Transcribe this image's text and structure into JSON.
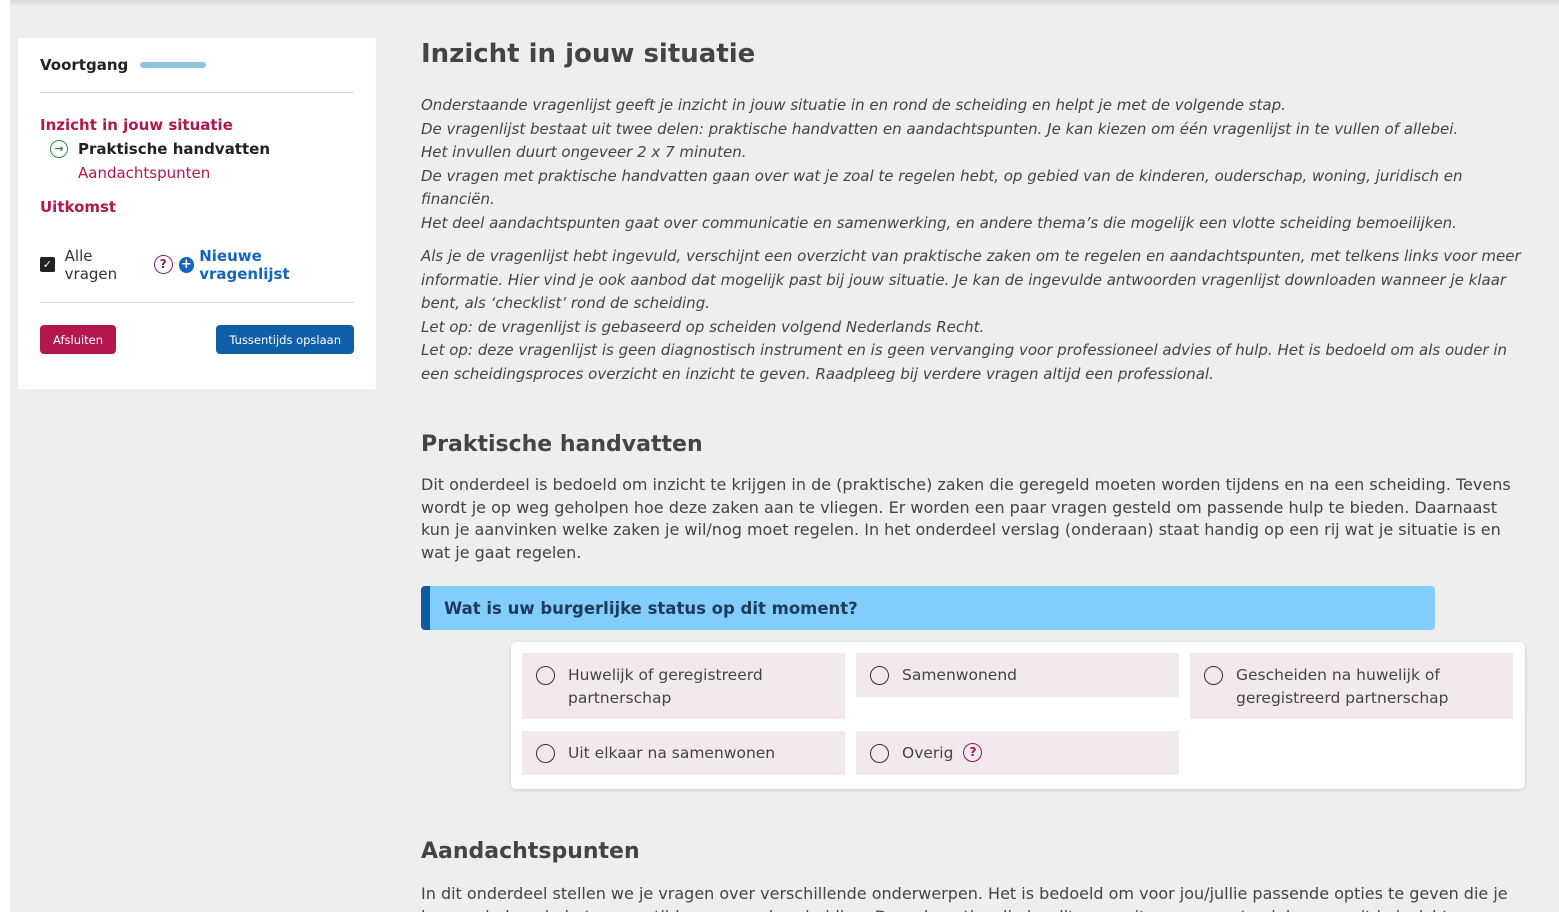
{
  "sidebar": {
    "progress_label": "Voortgang",
    "nav": {
      "section1": "Inzicht in jouw situatie",
      "sub_active": "Praktische handvatten",
      "sub_other": "Aandachtspunten",
      "section2": "Uitkomst"
    },
    "all_questions_label": "Alle vragen",
    "new_questionnaire_label": "Nieuwe vragenlijst",
    "close_button": "Afsluiten",
    "save_button": "Tussentijds opslaan"
  },
  "main": {
    "title": "Inzicht in jouw situatie",
    "intro_block1": [
      "Onderstaande vragenlijst geeft je inzicht in jouw situatie in en rond de scheiding en helpt je met de volgende stap.",
      "De vragenlijst bestaat uit twee delen: praktische handvatten en aandachtspunten. Je kan kiezen om één vragenlijst in te vullen of allebei.",
      "Het invullen duurt ongeveer 2 x 7 minuten.",
      "De vragen met praktische handvatten gaan over wat je zoal te regelen hebt, op gebied van de kinderen, ouderschap, woning, juridisch en financiën.",
      "Het deel aandachtspunten gaat over communicatie en samenwerking, en andere thema’s die mogelijk een vlotte scheiding bemoeilijken."
    ],
    "intro_block2": [
      "Als je de vragenlijst hebt ingevuld, verschijnt een overzicht van praktische zaken om te regelen en aandachtspunten, met telkens links voor meer informatie. Hier vind je ook aanbod dat mogelijk past bij jouw situatie. Je kan de ingevulde antwoorden vragenlijst downloaden wanneer je klaar bent, als ‘checklist’ rond de scheiding.",
      "Let op: de vragenlijst is gebaseerd op scheiden volgend Nederlands Recht.",
      "Let op: deze vragenlijst is geen diagnostisch instrument en is geen vervanging voor professioneel advies of hulp. Het is bedoeld om als ouder in een scheidingsproces overzicht en inzicht te geven. Raadpleeg bij verdere vragen altijd een professional."
    ],
    "section_practical": {
      "title": "Praktische handvatten",
      "text": "Dit onderdeel is bedoeld om inzicht te krijgen in de (praktische) zaken die geregeld moeten worden tijdens en na een scheiding. Tevens wordt je op weg geholpen hoe deze zaken aan te vliegen.  Er worden een paar vragen gesteld om passende hulp te bieden. Daarnaast kun je aanvinken welke zaken je wil/nog moet regelen. In het onderdeel verslag (onderaan) staat handig op een rij wat je situatie is en wat je gaat regelen."
    },
    "question": {
      "text": "Wat is uw burgerlijke status op dit moment?",
      "options": [
        "Huwelijk of geregistreerd partnerschap",
        "Samenwonend",
        "Gescheiden na huwelijk of geregistreerd partnerschap",
        "Uit elkaar na samenwonen",
        "Overig"
      ]
    },
    "section_attention": {
      "title": "Aandachtspunten",
      "text": "In dit onderdeel stellen we je vragen over verschillende onderwerpen. Het is bedoeld om voor jou/jullie passende opties te geven die je kunnen helpen in het proces tijdens en na de scheiding. Door de opties die je wilt gaan uitvoeren aan te vinken, groeit je inzicht."
    }
  },
  "colors": {
    "accent": "#b3174d",
    "primary_blue": "#0f5fa8",
    "question_bg": "#81cdfb",
    "option_bg": "#f2e9ee"
  }
}
